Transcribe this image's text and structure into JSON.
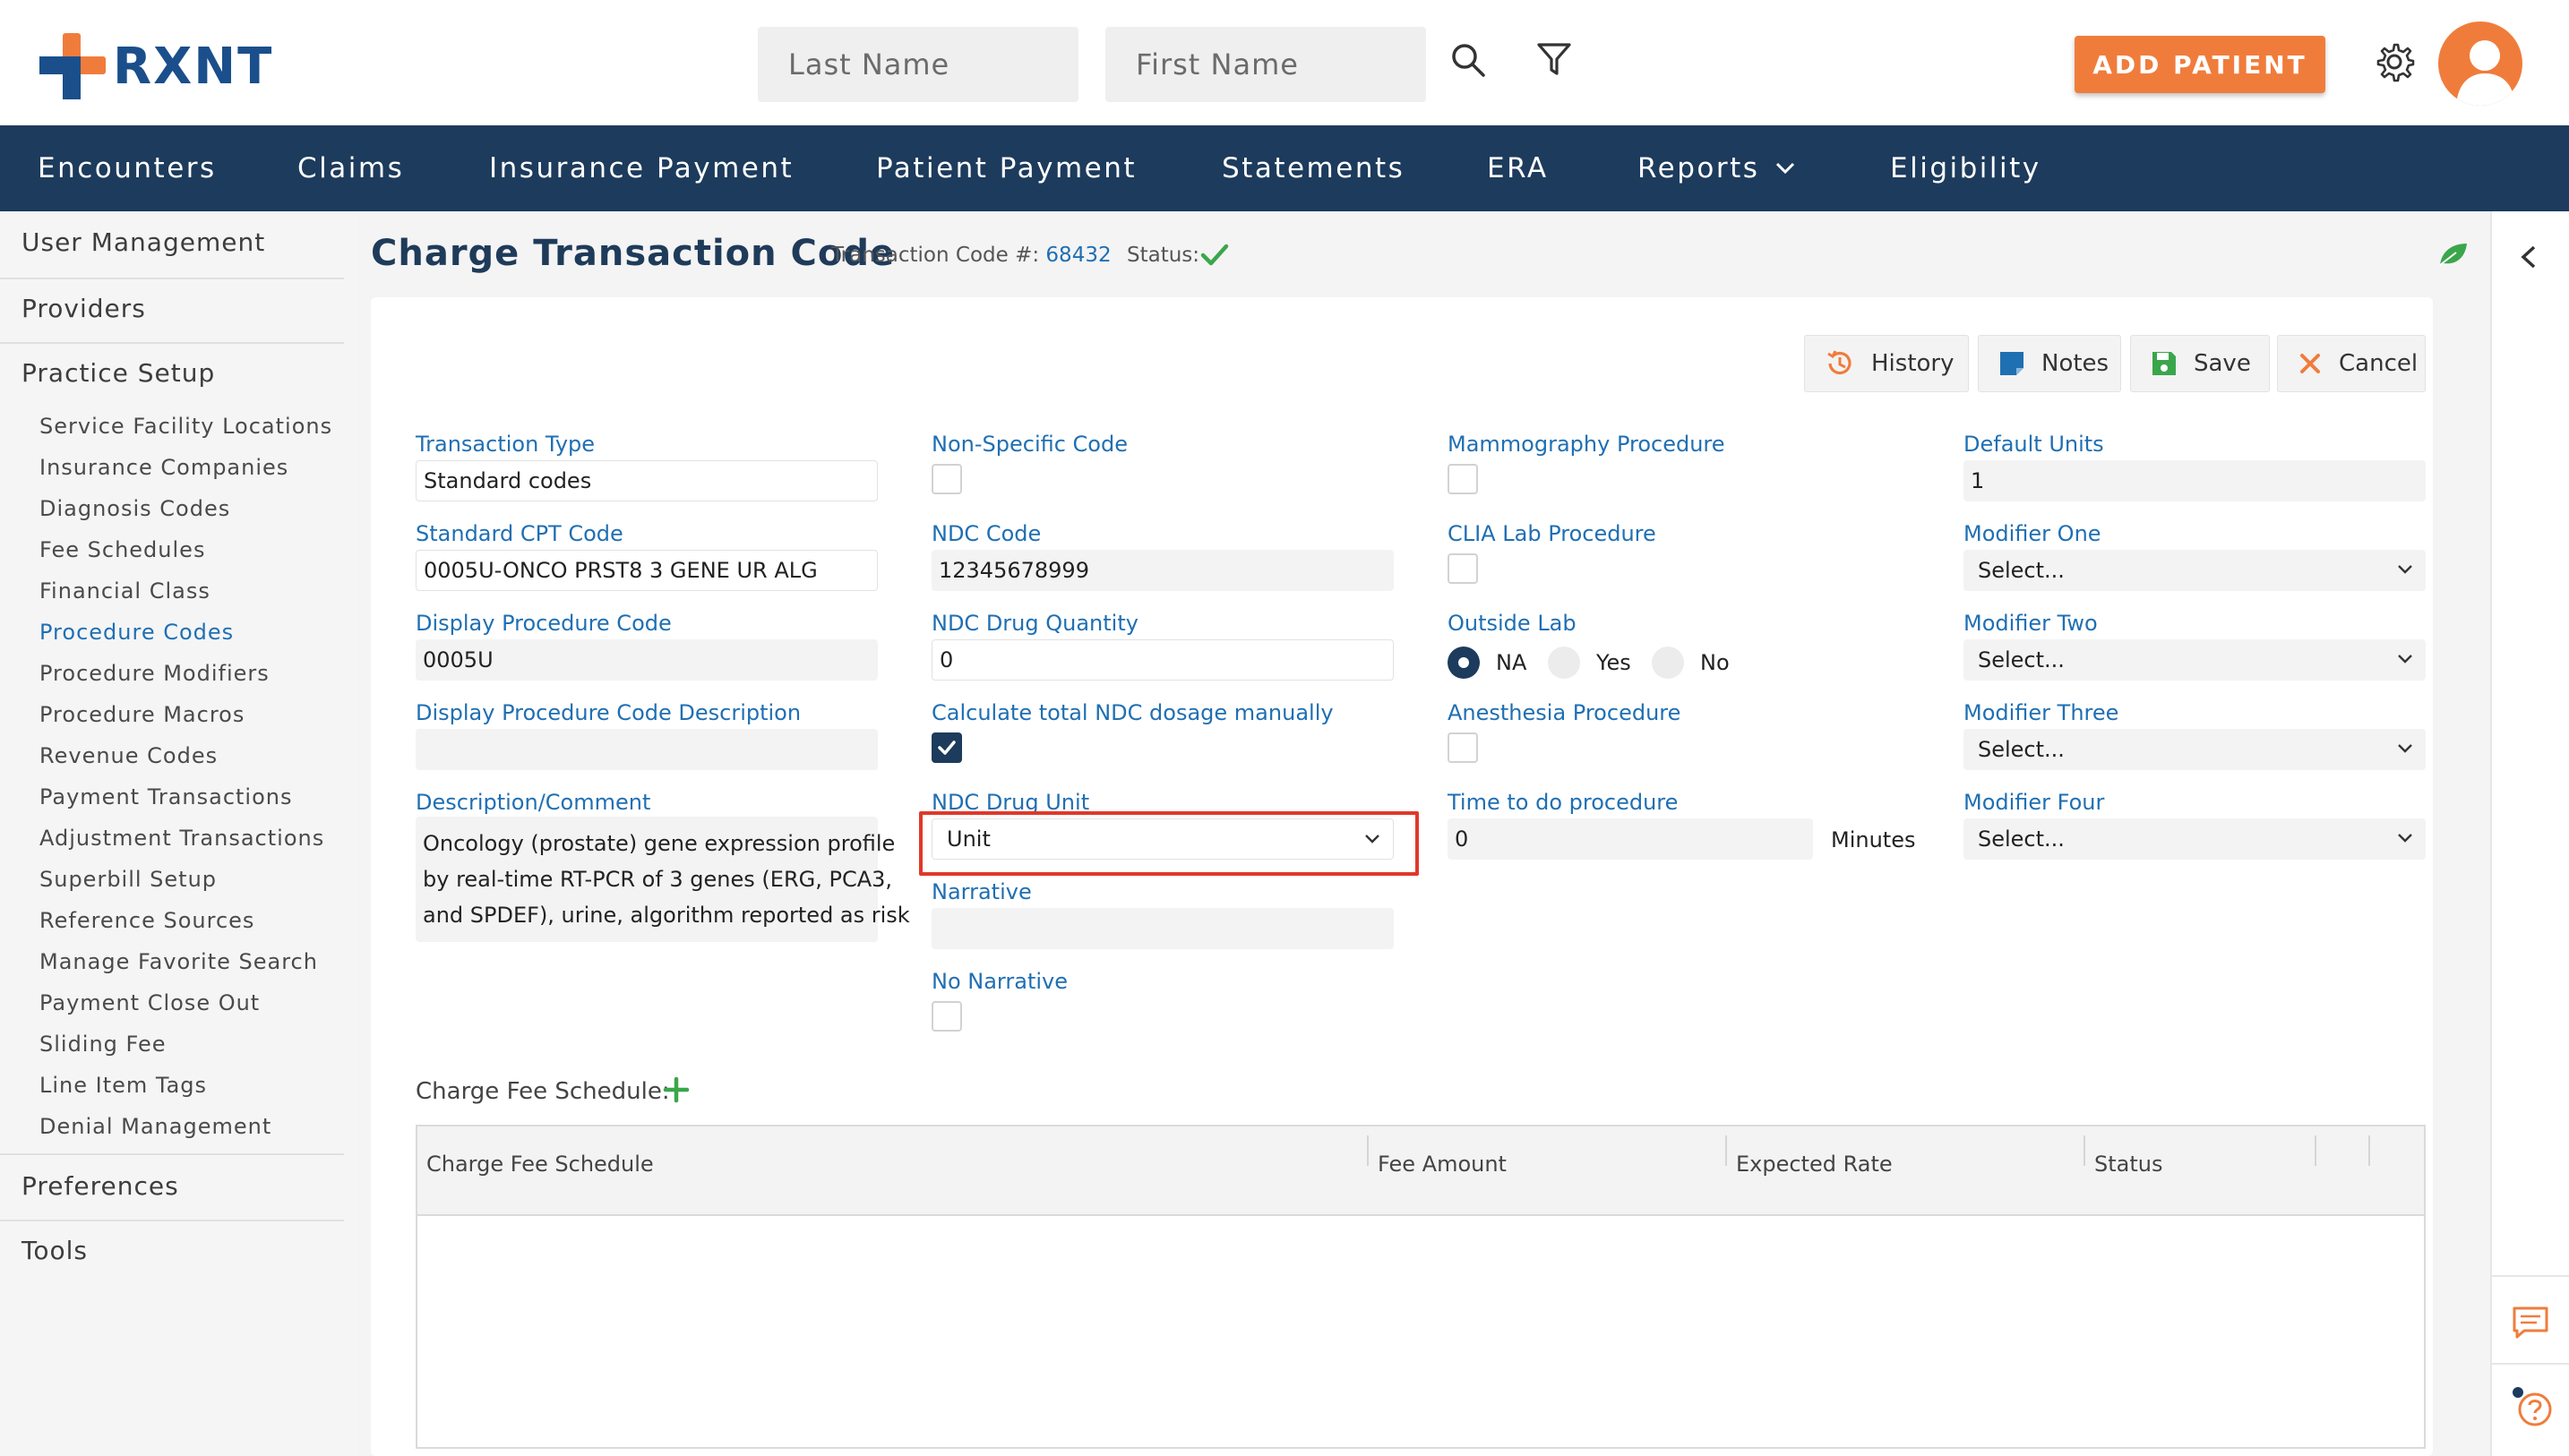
{
  "header": {
    "brand": "RXNT",
    "search_last_placeholder": "Last Name",
    "search_first_placeholder": "First Name",
    "add_patient_label": "ADD PATIENT"
  },
  "nav": {
    "items": [
      "Encounters",
      "Claims",
      "Insurance Payment",
      "Patient Payment",
      "Statements",
      "ERA",
      "Reports",
      "Eligibility"
    ]
  },
  "sidebar": {
    "sections": [
      "User Management",
      "Providers",
      "Practice Setup",
      "Preferences",
      "Tools"
    ],
    "practice_setup_items": [
      "Service Facility Locations",
      "Insurance Companies",
      "Diagnosis Codes",
      "Fee Schedules",
      "Financial Class",
      "Procedure Codes",
      "Procedure Modifiers",
      "Procedure Macros",
      "Revenue Codes",
      "Payment Transactions",
      "Adjustment Transactions",
      "Superbill Setup",
      "Reference Sources",
      "Manage Favorite Search",
      "Payment Close Out",
      "Sliding Fee",
      "Line Item Tags",
      "Denial Management"
    ],
    "active_item": "Procedure Codes"
  },
  "page": {
    "title": "Charge Transaction Code",
    "transaction_code_label": "Transaction Code #:",
    "transaction_code_value": "68432",
    "status_label": "Status:"
  },
  "toolbar": {
    "history_label": "History",
    "notes_label": "Notes",
    "save_label": "Save",
    "cancel_label": "Cancel"
  },
  "form": {
    "transaction_type_label": "Transaction Type",
    "transaction_type_value": "Standard codes",
    "standard_cpt_label": "Standard CPT Code",
    "standard_cpt_value": "0005U-ONCO PRST8 3 GENE UR ALG",
    "display_code_label": "Display Procedure Code",
    "display_code_value": "0005U",
    "display_desc_label": "Display Procedure Code Description",
    "display_desc_value": "",
    "description_label": "Description/Comment",
    "description_lines": [
      "Oncology (prostate) gene expression profile",
      "by real-time RT-PCR of 3 genes (ERG, PCA3,",
      "and SPDEF), urine, algorithm reported as risk"
    ],
    "non_specific_label": "Non-Specific Code",
    "ndc_code_label": "NDC Code",
    "ndc_code_value": "12345678999",
    "ndc_qty_label": "NDC Drug Quantity",
    "ndc_qty_value": "0",
    "calc_ndc_label": "Calculate total NDC dosage manually",
    "ndc_unit_label": "NDC Drug Unit",
    "ndc_unit_value": "Unit",
    "narrative_label": "Narrative",
    "narrative_value": "",
    "no_narrative_label": "No Narrative",
    "mammography_label": "Mammography Procedure",
    "clia_label": "CLIA Lab Procedure",
    "outside_lab_label": "Outside Lab",
    "outside_lab_options": [
      "NA",
      "Yes",
      "No"
    ],
    "anesthesia_label": "Anesthesia Procedure",
    "time_label": "Time to do procedure",
    "time_value": "0",
    "time_unit": "Minutes",
    "default_units_label": "Default Units",
    "default_units_value": "1",
    "modifier_one_label": "Modifier One",
    "modifier_two_label": "Modifier Two",
    "modifier_three_label": "Modifier Three",
    "modifier_four_label": "Modifier Four",
    "select_placeholder": "Select..."
  },
  "fee_schedule": {
    "label": "Charge Fee Schedule:",
    "columns": [
      "Charge Fee Schedule",
      "Fee Amount",
      "Expected Rate",
      "Status"
    ]
  },
  "colors": {
    "navy": "#1d3b5c",
    "accent_blue": "#1f6fb3",
    "orange": "#f07c3c",
    "green": "#3aa64b",
    "highlight_red": "#e0382a"
  }
}
